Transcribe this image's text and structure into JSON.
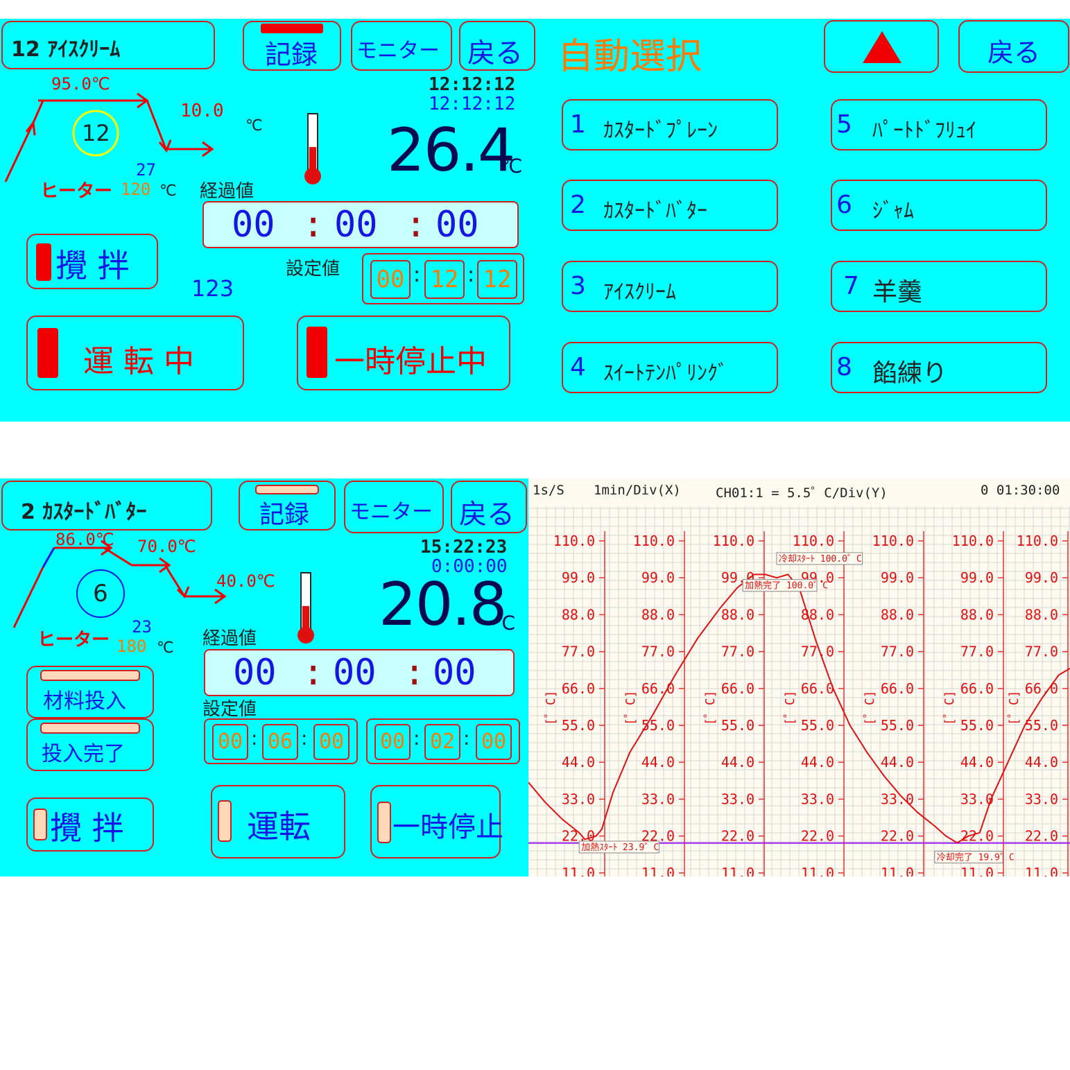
{
  "colors": {
    "panel_bg": "#00ffff",
    "accent_red": "#f00000",
    "accent_blue": "#1515e6",
    "accent_orange": "#ff7a00",
    "lamp_off": "#ffd9b8",
    "chart_bg": "#fffaf0",
    "chart_grid": "#c8c8c8",
    "chart_line": "#e01010",
    "chart_baseline": "#a020f0"
  },
  "screen1": {
    "title": "12 ｱｲｽｸﾘｰﾑ",
    "record": "記録",
    "monitor": "モニター",
    "back": "戻る",
    "temp_hold": "95.0℃",
    "temp_cool_value": "10.0",
    "temp_cool_unit": "℃",
    "step_number": "12",
    "heater_label": "ヒーター",
    "heater_top": "27",
    "heater_bottom": "120",
    "heater_unit": "℃",
    "time1": "12:12:12",
    "time2": "12:12:12",
    "current_temp": "26.4",
    "current_temp_unit": "℃",
    "elapsed_label": "経過値",
    "elapsed_h": "00",
    "elapsed_m": "00",
    "elapsed_s": "00",
    "colon": ":",
    "set_label": "設定値",
    "set_h": "00",
    "set_m": "12",
    "set_s": "12",
    "stir": "攪 拌",
    "count": "123",
    "running": "運 転 中",
    "paused": "一時停止中"
  },
  "select": {
    "title": "自動選択",
    "up_icon": "triangle-up-icon",
    "back": "戻る",
    "items": [
      {
        "num": "1",
        "label": "ｶｽﾀｰﾄﾞﾌﾟﾚｰﾝ"
      },
      {
        "num": "2",
        "label": "ｶｽﾀｰﾄﾞﾊﾞﾀｰ"
      },
      {
        "num": "3",
        "label": "ｱｲｽｸﾘｰﾑ"
      },
      {
        "num": "4",
        "label": "ｽｲｰﾄﾃﾝﾊﾟﾘﾝｸﾞ"
      },
      {
        "num": "5",
        "label": "ﾊﾟｰﾄﾄﾞﾌﾘｭｲ"
      },
      {
        "num": "6",
        "label": "ｼﾞｬﾑ"
      },
      {
        "num": "7",
        "label": "羊羹"
      },
      {
        "num": "8",
        "label": "餡練り"
      }
    ]
  },
  "screen2": {
    "title": "2 ｶｽﾀｰﾄﾞﾊﾞﾀｰ",
    "record": "記録",
    "monitor": "モニター",
    "back": "戻る",
    "temp1": "86.0℃",
    "temp2": "70.0℃",
    "temp3": "40.0℃",
    "step_number": "6",
    "heater_label": "ヒーター",
    "heater_top": "23",
    "heater_bottom": "180",
    "heater_unit": "℃",
    "time1": "15:22:23",
    "time2": "0:00:00",
    "current_temp": "20.8",
    "current_temp_unit": "℃",
    "elapsed_label": "経過値",
    "elapsed_h": "00",
    "elapsed_m": "00",
    "elapsed_s": "00",
    "colon": ":",
    "set_label": "設定値",
    "set_a_h": "00",
    "set_a_m": "06",
    "set_a_s": "00",
    "set_b_h": "00",
    "set_b_m": "02",
    "set_b_s": "00",
    "material_in": "材料投入",
    "input_done": "投入完了",
    "stir": "攪 拌",
    "run": "運転",
    "pause": "一時停止"
  },
  "chart_data": {
    "type": "line",
    "header_rate": "1s/S",
    "header_x": "1min/Div(X)",
    "header_y": "CH01:1 = 5.5゜C/Div(Y)",
    "header_time": "0 01:30:00",
    "unit_label": "[゜C]",
    "ylim": [
      11.0,
      110.0
    ],
    "tick_labels": [
      "110.0",
      "99.0",
      "88.0",
      "77.0",
      "66.0",
      "55.0",
      "44.0",
      "33.0",
      "22.0",
      "11.0"
    ],
    "ticks": [
      110.0,
      99.0,
      88.0,
      77.0,
      66.0,
      55.0,
      44.0,
      33.0,
      22.0,
      11.0
    ],
    "baseline": 19.9,
    "series": [
      {
        "points": [
          [
            0,
            38
          ],
          [
            3,
            32
          ],
          [
            6,
            27
          ],
          [
            9,
            23
          ],
          [
            10,
            21
          ],
          [
            12,
            22
          ],
          [
            13,
            24
          ],
          [
            15,
            35
          ],
          [
            18,
            47
          ],
          [
            22,
            58
          ],
          [
            26,
            70
          ],
          [
            30,
            81
          ],
          [
            34,
            90
          ],
          [
            37,
            96
          ],
          [
            40,
            100
          ],
          [
            42,
            100
          ],
          [
            44,
            99
          ],
          [
            46,
            100
          ],
          [
            48,
            96
          ],
          [
            51,
            80
          ],
          [
            54,
            66
          ],
          [
            57,
            55
          ],
          [
            60,
            47
          ],
          [
            63,
            40
          ],
          [
            66,
            34
          ],
          [
            69,
            29
          ],
          [
            72,
            25
          ],
          [
            74,
            22
          ],
          [
            76,
            20
          ],
          [
            78,
            22
          ],
          [
            80,
            23
          ],
          [
            82,
            33
          ],
          [
            85,
            44
          ],
          [
            88,
            55
          ],
          [
            91,
            63
          ],
          [
            94,
            70
          ],
          [
            96,
            72
          ]
        ]
      }
    ],
    "annotations": [
      {
        "text": "冷却ｽﾀｰﾄ 100.0゜C",
        "x": 44,
        "y": 104
      },
      {
        "text": "加熱完了 100.0゜C",
        "x": 38,
        "y": 96
      },
      {
        "text": "加熱ｽﾀｰﾄ 23.9゜C",
        "x": 9,
        "y": 18
      },
      {
        "text": "冷却完了 19.9゜C",
        "x": 72,
        "y": 15
      }
    ]
  }
}
